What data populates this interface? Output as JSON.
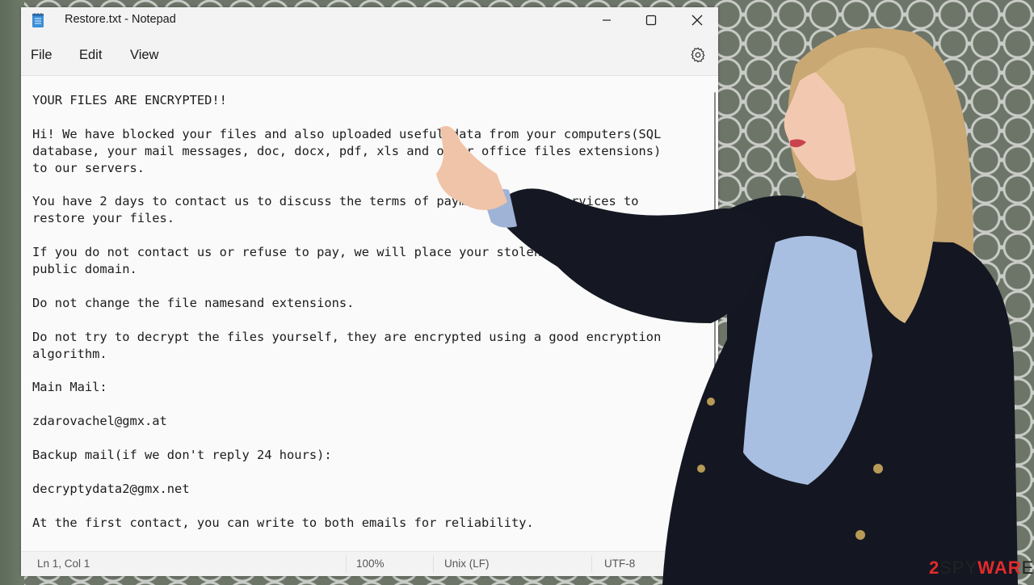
{
  "window": {
    "title": "Restore.txt - Notepad",
    "app_icon": "notepad-icon",
    "controls": {
      "minimize": "minimize-icon",
      "maximize": "maximize-icon",
      "close": "close-icon"
    }
  },
  "menu": {
    "items": [
      {
        "label": "File"
      },
      {
        "label": "Edit"
      },
      {
        "label": "View"
      }
    ],
    "settings_icon": "gear-icon"
  },
  "editor": {
    "content": "YOUR FILES ARE ENCRYPTED!!\n\nHi! We have blocked your files and also uploaded useful data from your computers(SQL\ndatabase, your mail messages, doc, docx, pdf, xls and other office files extensions)\nto our servers.\n\nYou have 2 days to contact us to discuss the terms of payment for our services to\nrestore your files.\n\nIf you do not contact us or refuse to pay, we will place your stolen files in the\npublic domain.\n\nDo not change the file namesand extensions.\n\nDo not try to decrypt the files yourself, they are encrypted using a good encryption\nalgorithm.\n\nMain Mail:\n\nzdarovachel@gmx.at\n\nBackup mail(if we don't reply 24 hours):\n\ndecryptydata2@gmx.net\n\nAt the first contact, you can write to both emails for reliability."
  },
  "statusbar": {
    "position": "Ln 1, Col 1",
    "zoom": "100%",
    "line_ending": "Unix (LF)",
    "encoding": "UTF-8"
  },
  "watermark": {
    "part1": "2",
    "part2": "SPY",
    "part3": "WAR",
    "part4": "E"
  },
  "colors": {
    "window_bg": "#f3f3f3",
    "editor_bg": "#fafafa",
    "watermark_red": "#e32b2b"
  }
}
